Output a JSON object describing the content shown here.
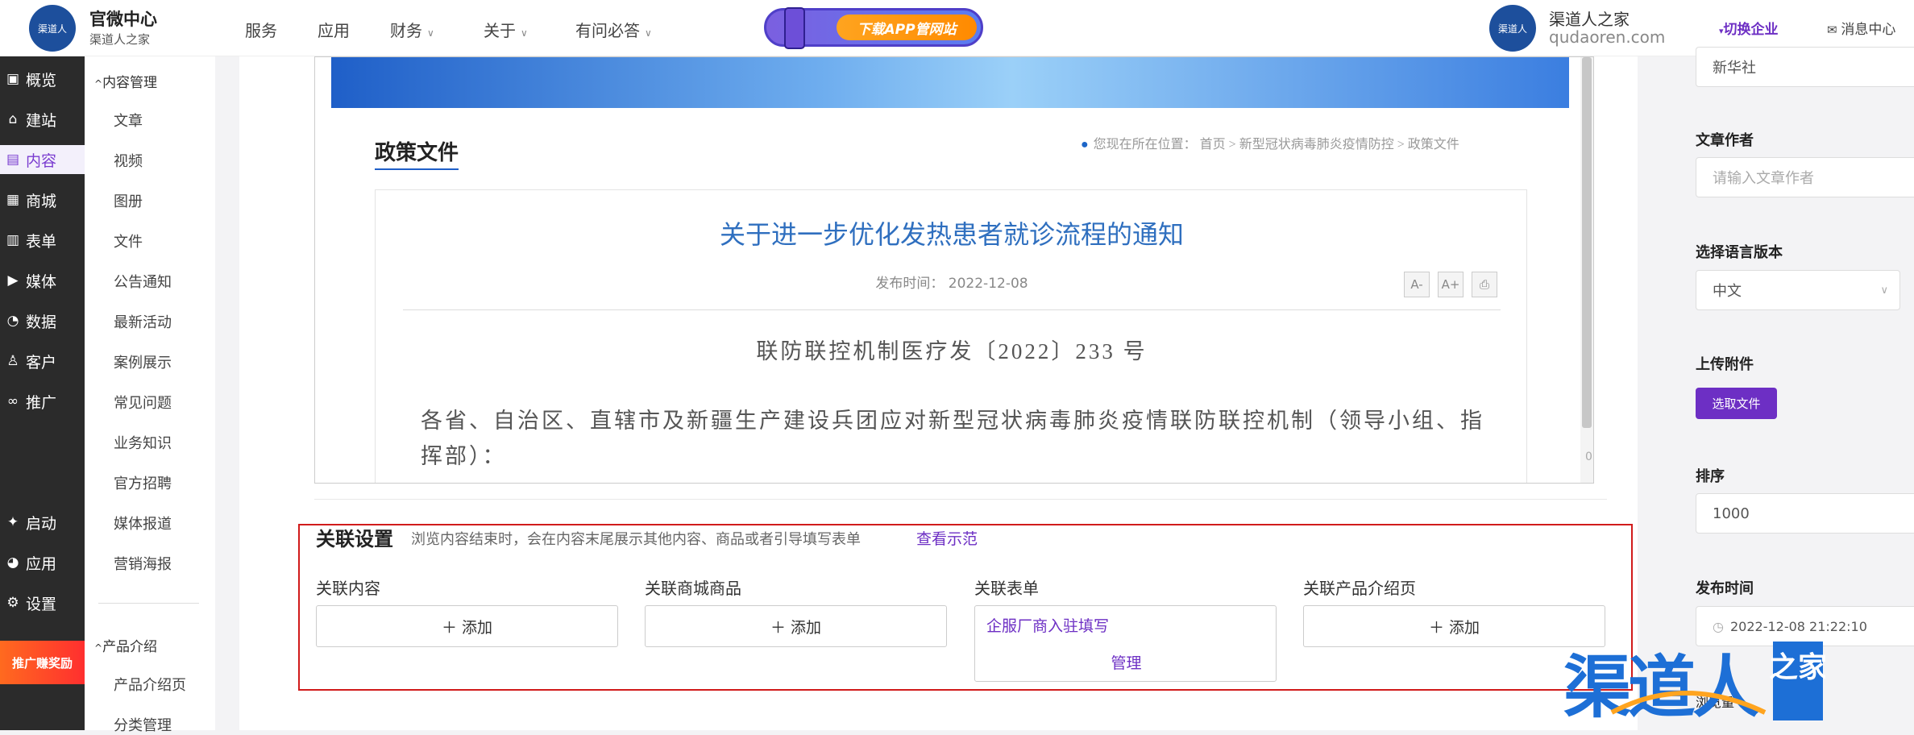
{
  "header": {
    "brand_title": "官微中心",
    "brand_subtitle": "渠道人之家",
    "logo_text": "渠道人",
    "nav": [
      {
        "label": "服务",
        "has_dropdown": false
      },
      {
        "label": "应用",
        "has_dropdown": false
      },
      {
        "label": "财务",
        "has_dropdown": true
      },
      {
        "label": "关于",
        "has_dropdown": true
      },
      {
        "label": "有问必答",
        "has_dropdown": true
      }
    ],
    "banner_text": "下载APP管网站",
    "user_name": "渠道人之家",
    "user_domain": "qudaoren.com",
    "switch_label": "切换企业",
    "message_label": "消息中心"
  },
  "sidebar": {
    "items": [
      {
        "label": "概览",
        "icon": "overview-icon",
        "glyph": "▣"
      },
      {
        "label": "建站",
        "icon": "home-icon",
        "glyph": "⌂"
      },
      {
        "label": "内容",
        "icon": "document-icon",
        "glyph": "▤",
        "active": true
      },
      {
        "label": "商城",
        "icon": "shop-icon",
        "glyph": "▦"
      },
      {
        "label": "表单",
        "icon": "form-icon",
        "glyph": "▥"
      },
      {
        "label": "媒体",
        "icon": "media-icon",
        "glyph": "▶"
      },
      {
        "label": "数据",
        "icon": "data-icon",
        "glyph": "◔"
      },
      {
        "label": "客户",
        "icon": "user-icon",
        "glyph": "♙"
      },
      {
        "label": "推广",
        "icon": "link-icon",
        "glyph": "∞"
      },
      {
        "label": "启动",
        "icon": "launch-icon",
        "glyph": "✦"
      },
      {
        "label": "应用",
        "icon": "apps-icon",
        "glyph": "◕"
      },
      {
        "label": "设置",
        "icon": "gear-icon",
        "glyph": "⚙"
      }
    ],
    "promo_text": "推广赚奖励"
  },
  "subnav": {
    "group1": "内容管理",
    "items1": [
      "文章",
      "视频",
      "图册",
      "文件",
      "公告通知",
      "最新活动",
      "案例展示",
      "常见问题",
      "业务知识",
      "官方招聘",
      "媒体报道",
      "营销海报"
    ],
    "group2": "产品介绍",
    "items2": [
      "产品介绍页",
      "分类管理"
    ]
  },
  "preview": {
    "section_title": "政策文件",
    "breadcrumb": "您现在所在位置：  首页  >  新型冠状病毒肺炎疫情防控  >  政策文件",
    "article_title": "关于进一步优化发热患者就诊流程的通知",
    "publish_time": "发布时间：  2022-12-08",
    "tools": [
      "A-",
      "A+",
      "⎙"
    ],
    "doc_number": "联防联控机制医疗发〔2022〕233 号",
    "body": "各省、自治区、直辖市及新疆生产建设兵团应对新型冠状病毒肺炎疫情联防联控机制（领导小组、指挥部）：",
    "scroll_num": "0"
  },
  "relation": {
    "title": "关联设置",
    "desc": "浏览内容结束时，会在内容末尾展示其他内容、商品或者引导填写表单",
    "example_link": "查看示范",
    "content_label": "关联内容",
    "goods_label": "关联商城商品",
    "form_label": "关联表单",
    "product_label": "关联产品介绍页",
    "add_label": "＋  添加",
    "form_value": "企服厂商入驻填写",
    "manage_label": "管理"
  },
  "right_panel": {
    "source_value": "新华社",
    "author_label": "文章作者",
    "author_placeholder": "请输入文章作者",
    "language_label": "选择语言版本",
    "language_value": "中文",
    "attach_label": "上传附件",
    "attach_button": "选取文件",
    "sort_label": "排序",
    "sort_value": "1000",
    "publish_label": "发布时间",
    "publish_value": "2022-12-08 21:22:10",
    "views_label": "浏览量"
  },
  "watermark": {
    "main": "渠道人",
    "side": "之家"
  }
}
